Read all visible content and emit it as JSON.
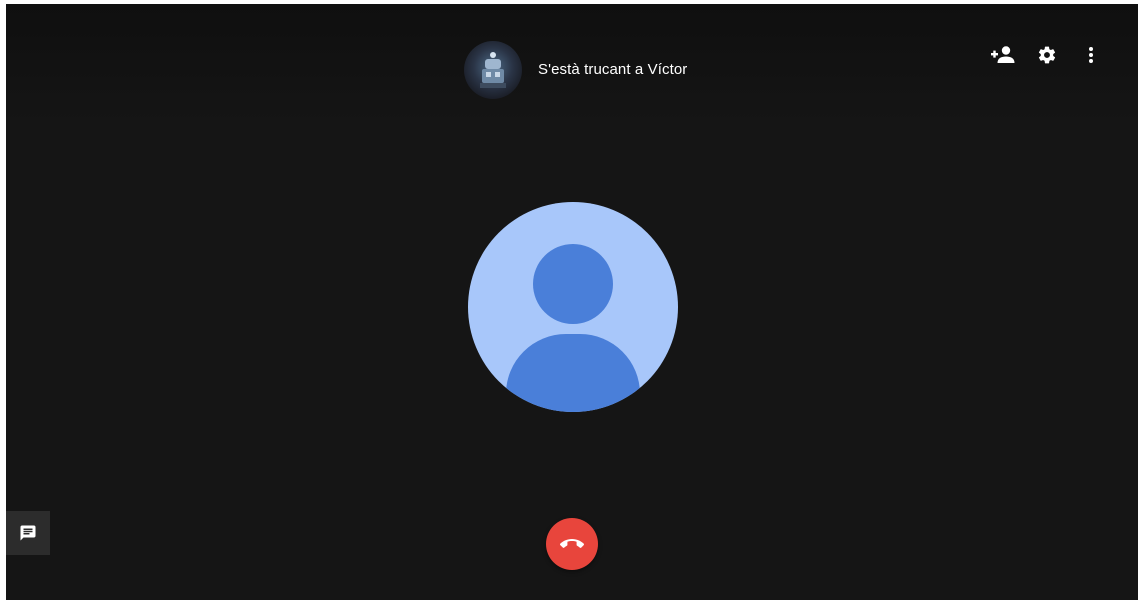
{
  "header": {
    "status_text": "S'està trucant a Víctor",
    "caller_avatar_icon": "profile-photo",
    "actions": [
      {
        "name": "add-person-icon"
      },
      {
        "name": "settings-icon"
      },
      {
        "name": "more-vert-icon"
      }
    ]
  },
  "main": {
    "contact_avatar_icon": "default-person-avatar"
  },
  "controls": {
    "chat_icon": "chat-icon",
    "hangup_icon": "call-end-icon"
  },
  "colors": {
    "background": "#151515",
    "avatar_bg": "#a8c7fa",
    "avatar_figure": "#4a7fd9",
    "hangup": "#e8453c",
    "text": "#ffffff"
  }
}
